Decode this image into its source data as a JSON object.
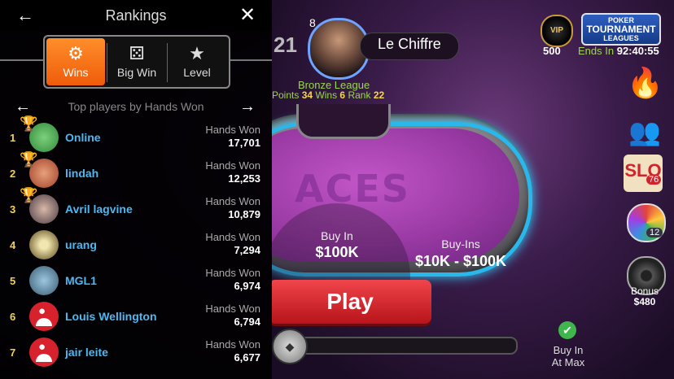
{
  "rankings": {
    "title": "Rankings",
    "tabs": [
      {
        "label": "Wins",
        "icon": "medal-icon",
        "active": true
      },
      {
        "label": "Big Win",
        "icon": "dice-icon",
        "active": false
      },
      {
        "label": "Level",
        "icon": "star-icon",
        "active": false
      }
    ],
    "subtitle": "Top players by Hands Won",
    "hands_won_label": "Hands Won",
    "players": [
      {
        "rank": "1",
        "name": "Online",
        "hands": "17,701",
        "trophy": "gold"
      },
      {
        "rank": "2",
        "name": "lindah",
        "hands": "12,253",
        "trophy": "silver"
      },
      {
        "rank": "3",
        "name": "Avril lagvine",
        "hands": "10,879",
        "trophy": "bronze"
      },
      {
        "rank": "4",
        "name": "urang",
        "hands": "7,294"
      },
      {
        "rank": "5",
        "name": "MGL1",
        "hands": "6,974"
      },
      {
        "rank": "6",
        "name": "Louis Wellington",
        "hands": "6,794"
      },
      {
        "rank": "7",
        "name": "jair leite",
        "hands": "6,677"
      }
    ]
  },
  "game": {
    "player_level": "8",
    "player_name": "Le Chiffre",
    "rank_number_partial": "21",
    "league_name": "Bronze League",
    "league_points_label": "Points",
    "league_points": "34",
    "league_wins_label": "Wins",
    "league_wins": "6",
    "league_rank_label": "Rank",
    "league_rank": "22",
    "vip_label": "VIP",
    "vip_points": "500",
    "tournament_logo": {
      "line1": "POKER",
      "line2": "TOURNAMENT",
      "line3": "LEAGUES"
    },
    "ends_in_label": "Ends In",
    "ends_in_time": "92:40:55",
    "table_logo": "ACES",
    "buy_in_label": "Buy In",
    "buy_in_value": "$100K",
    "buy_ins_label": "Buy-Ins",
    "buy_ins_range": "$10K - $100K",
    "play_label": "Play",
    "slots_label": "SLO",
    "slots_badge": "76",
    "spin_badge": "12",
    "bonus_label": "Bonus",
    "bonus_amount": "$480",
    "buy_in_at_max_label_1": "Buy In",
    "buy_in_at_max_label_2": "At Max",
    "colors": {
      "accent": "#ef5c0a",
      "name_blue": "#4db8f2",
      "rank_gold": "#f4d34a",
      "league_green": "#9bd64a",
      "play_red": "#d0242c"
    }
  }
}
